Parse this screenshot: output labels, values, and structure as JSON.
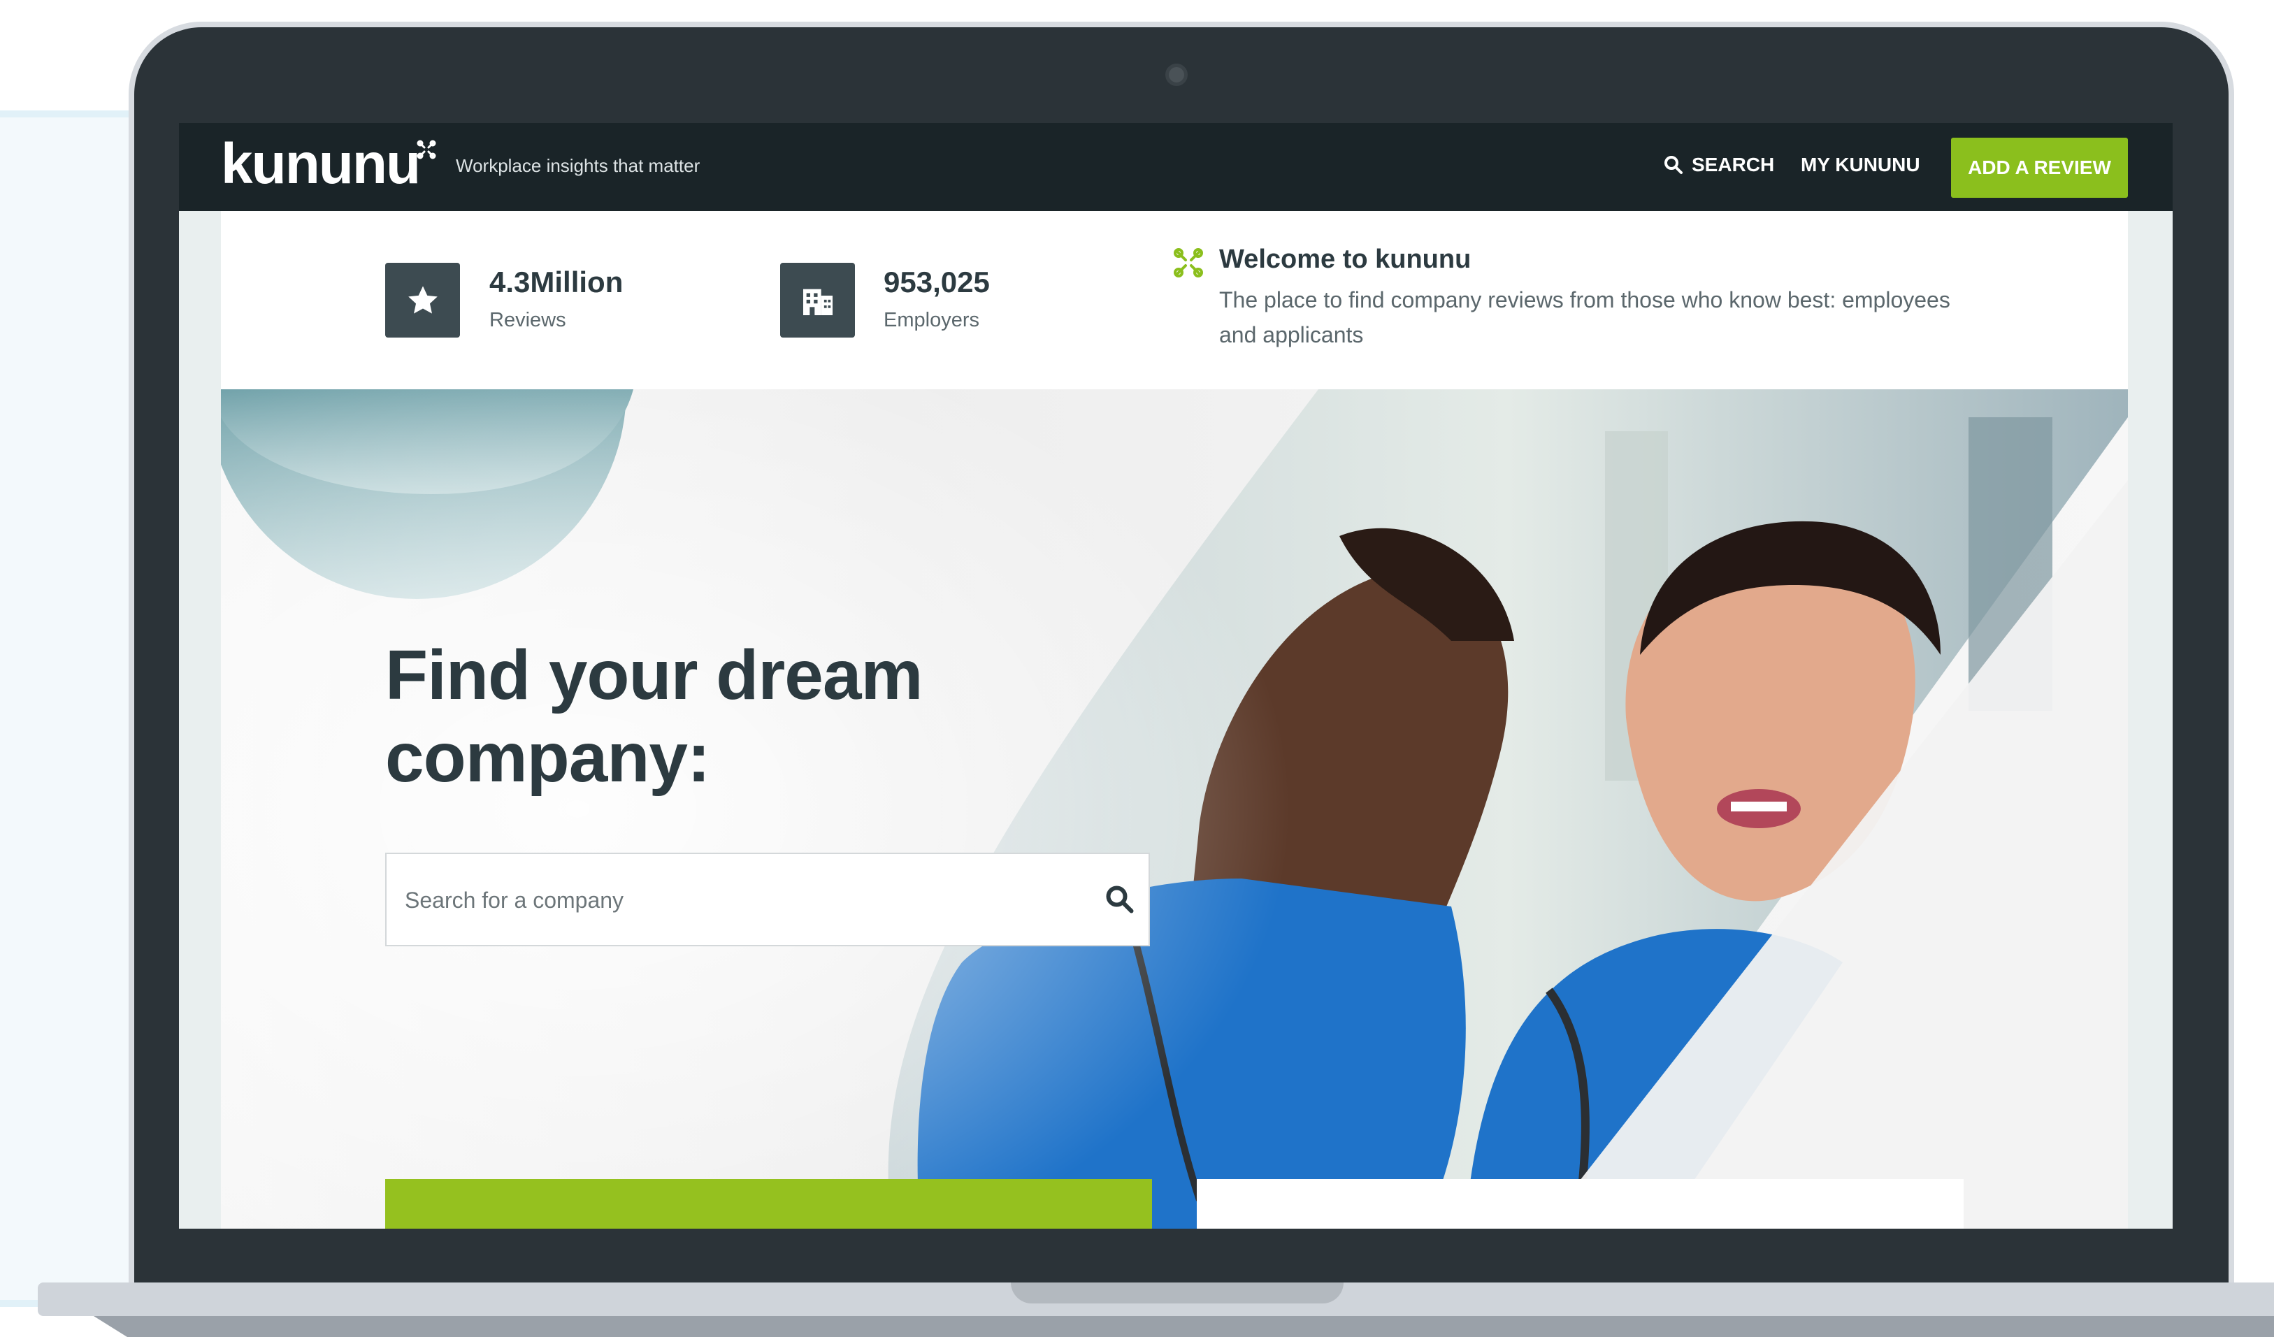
{
  "header": {
    "logo_text": "kununu",
    "tagline": "Workplace insights that matter",
    "nav": {
      "search_label": "SEARCH",
      "my_label": "MY KUNUNU",
      "add_review_label": "ADD A REVIEW"
    }
  },
  "stats": [
    {
      "value": "4.3Million",
      "label": "Reviews",
      "icon": "star-icon"
    },
    {
      "value": "953,025",
      "label": "Employers",
      "icon": "building-icon"
    }
  ],
  "welcome": {
    "title": "Welcome to kununu",
    "text": "The place to find company reviews from those who know best: employees and applicants"
  },
  "hero": {
    "title_line1": "Find your dream",
    "title_line2": "company:",
    "search_placeholder": "Search for a company"
  },
  "colors": {
    "accent_green": "#8bbf1d",
    "header_dark": "#1a2428",
    "text_dark": "#2c3a40",
    "scrubs_blue": "#1f73c9"
  }
}
